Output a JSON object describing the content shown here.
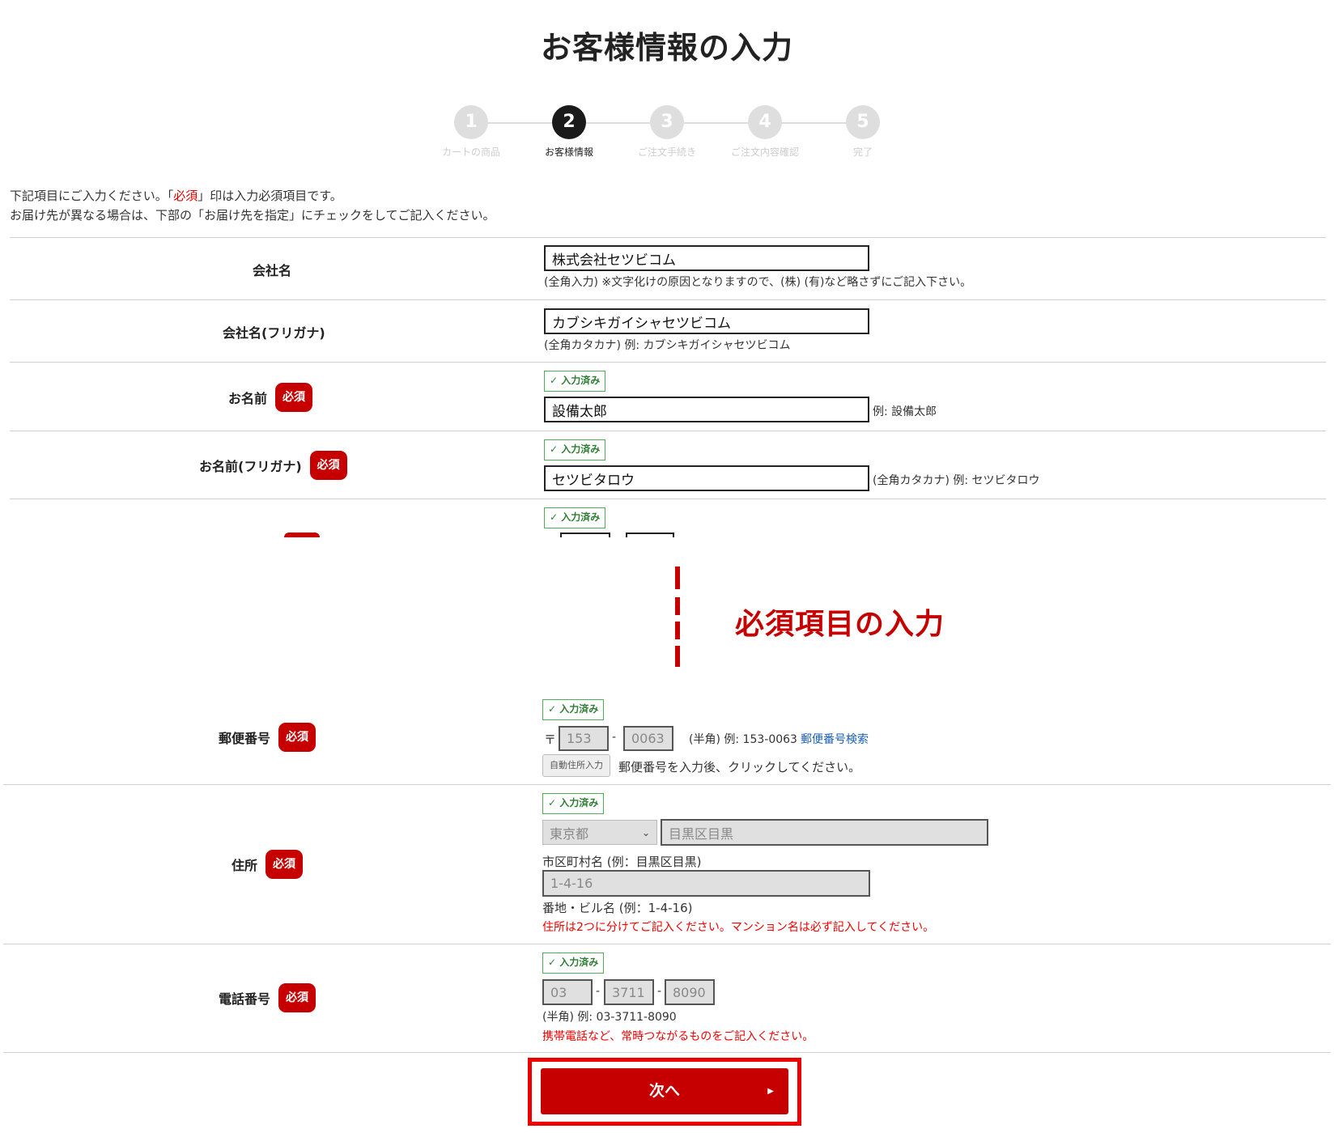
{
  "page_title": "お客様情報の入力",
  "steps": [
    {
      "num": "1",
      "label": "カートの商品"
    },
    {
      "num": "2",
      "label": "お客様情報"
    },
    {
      "num": "3",
      "label": "ご注文手続き"
    },
    {
      "num": "4",
      "label": "ご注文内容確認"
    },
    {
      "num": "5",
      "label": "完了"
    }
  ],
  "intro": {
    "line1_a": "下記項目にご入力ください。「",
    "line1_req": "必須",
    "line1_b": "」印は入力必須項目です。",
    "line2": "お届け先が異なる場合は、下部の「お届け先を指定」にチェックをしてご記入ください。"
  },
  "required_badge": "必須",
  "filled_chip": "✓ 入力済み",
  "company": {
    "label": "会社名",
    "value": "株式会社セツビコム",
    "note": "(全角入力) ※文字化けの原因となりますので、(株) (有)など略さずにご記入下さい。"
  },
  "company_kana": {
    "label": "会社名(フリガナ)",
    "value": "カブシキガイシャセツビコム",
    "note": "(全角カタカナ) 例: カブシキガイシャセツビコム"
  },
  "name": {
    "label": "お名前",
    "value": "設備太郎",
    "note": "例: 設備太郎"
  },
  "name_kana": {
    "label": "お名前(フリガナ)",
    "value": "セツビタロウ",
    "note": "(全角カタカナ) 例: セツビタロウ"
  },
  "separator_title": "必須項目の入力",
  "postal": {
    "label": "郵便番号",
    "prefix": "〒",
    "value1": "153",
    "dash": "-",
    "value2": "0063",
    "note": "(半角) 例: 153-0063",
    "search_link": "郵便番号検索",
    "auto_button": "自動住所入力",
    "auto_note": "郵便番号を入力後、クリックしてください。"
  },
  "address": {
    "label": "住所",
    "prefecture": "東京都",
    "city": "目黒区目黒",
    "city_note": "市区町村名 (例：目黒区目黒)",
    "street": "1-4-16",
    "street_note": "番地・ビル名 (例：1-4-16)",
    "warning": "住所は2つに分けてご記入ください。マンション名は必ず記入してください。"
  },
  "phone": {
    "label": "電話番号",
    "value1": "03",
    "value2": "3711",
    "value3": "8090",
    "dash": "-",
    "note": "(半角) 例: 03-3711-8090",
    "warning": "携帯電話など、常時つながるものをご記入ください。"
  },
  "next_button": "次へ",
  "next_arrow": "▶",
  "colors": {
    "accent": "#c60000",
    "filled": "#4caf50",
    "link": "#1a5fb4"
  }
}
